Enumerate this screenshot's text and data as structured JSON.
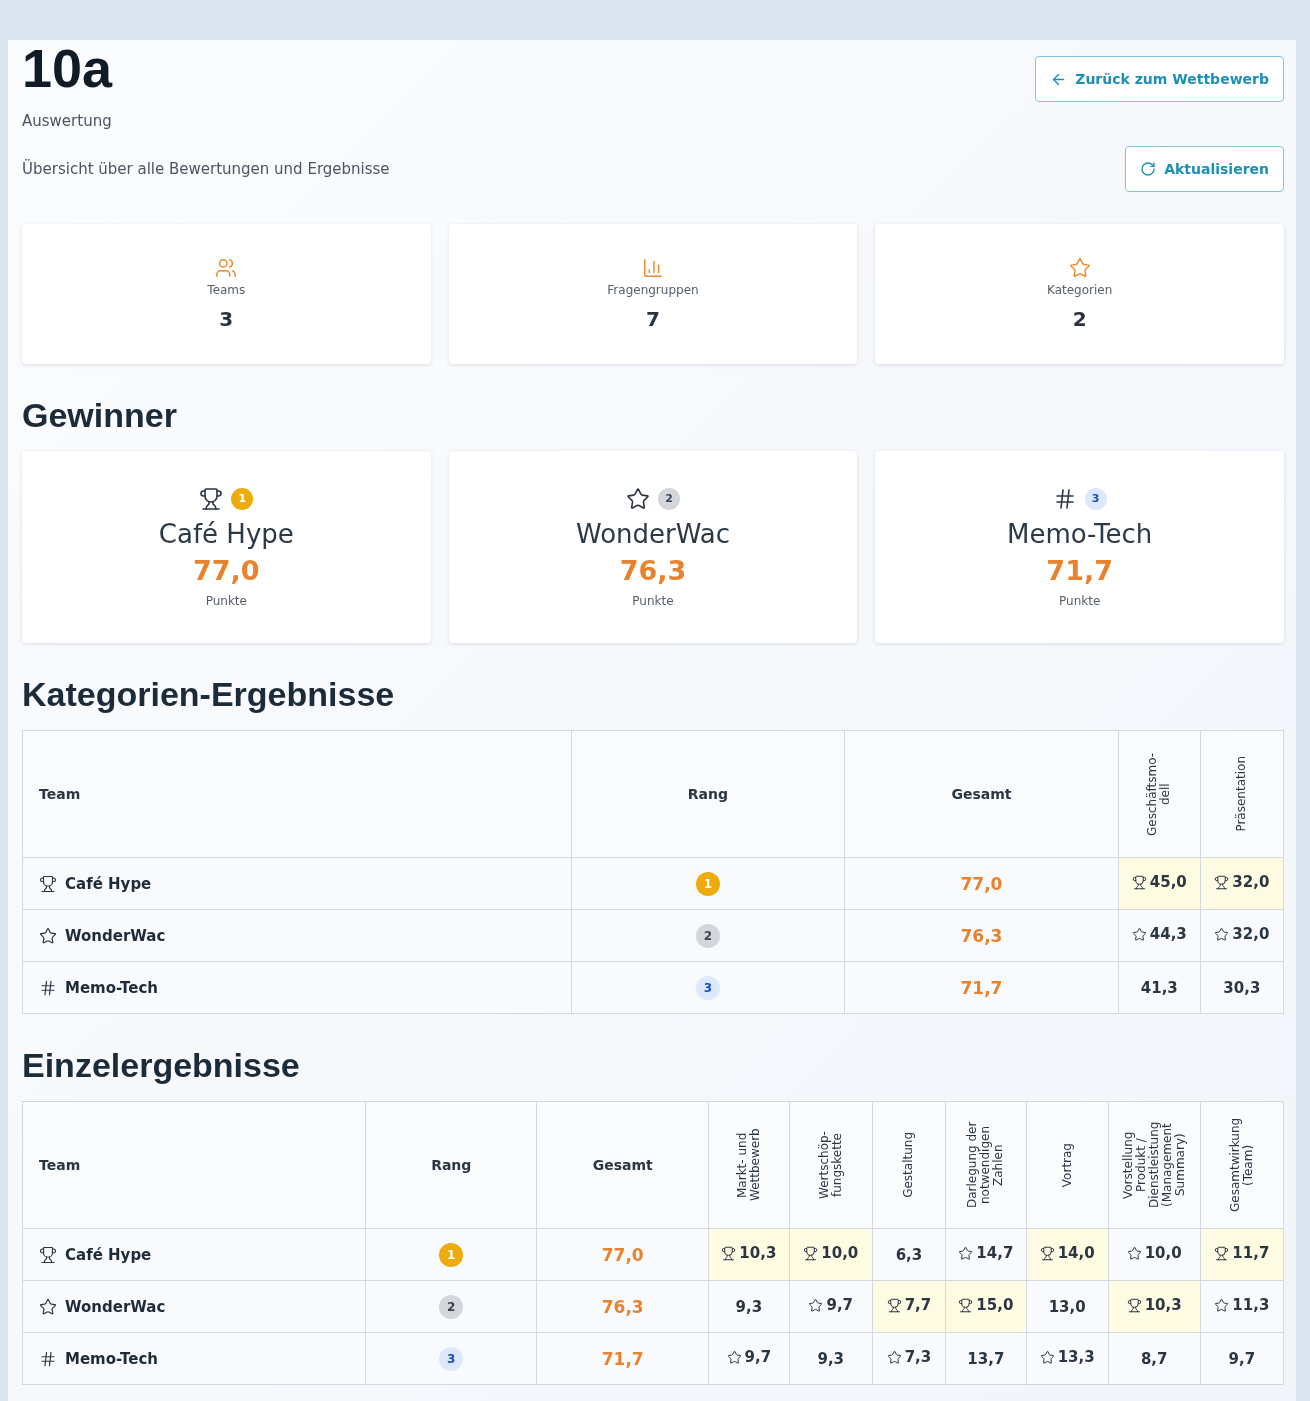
{
  "header": {
    "title": "10a",
    "subtitle": "Auswertung",
    "description": "Übersicht über alle Bewertungen und Ergebnisse",
    "back_button": "Zurück zum Wettbewerb",
    "refresh_button": "Aktualisieren"
  },
  "stats": [
    {
      "kind": "teams",
      "label": "Teams",
      "value": "3"
    },
    {
      "kind": "groups",
      "label": "Fragengruppen",
      "value": "7"
    },
    {
      "kind": "categories",
      "label": "Kategorien",
      "value": "2"
    }
  ],
  "winners_heading": "Gewinner",
  "winners": [
    {
      "kind": "first",
      "badge": "1",
      "name": "Café Hype",
      "score": "77,0",
      "unit": "Punkte"
    },
    {
      "kind": "second",
      "badge": "2",
      "name": "WonderWac",
      "score": "76,3",
      "unit": "Punkte"
    },
    {
      "kind": "third",
      "badge": "3",
      "name": "Memo-Tech",
      "score": "71,7",
      "unit": "Punkte"
    }
  ],
  "category_results": {
    "heading": "Kategorien-Ergebnisse",
    "columns": [
      "Team",
      "Rang",
      "Gesamt",
      "Geschäftsmo-dell",
      "Präsentation"
    ],
    "rows": [
      {
        "kind": "first",
        "cells": [
          {
            "kind": "team",
            "text": "Café Hype"
          },
          {
            "kind": "rank",
            "text": "1"
          },
          {
            "kind": "total",
            "text": "77,0"
          },
          {
            "kind": "top",
            "text": "45,0"
          },
          {
            "kind": "top",
            "text": "32,0"
          }
        ]
      },
      {
        "kind": "second",
        "cells": [
          {
            "kind": "team",
            "text": "WonderWac"
          },
          {
            "kind": "rank",
            "text": "2"
          },
          {
            "kind": "total",
            "text": "76,3"
          },
          {
            "kind": "runner_up",
            "text": "44,3"
          },
          {
            "kind": "runner_up",
            "text": "32,0"
          }
        ]
      },
      {
        "kind": "third",
        "cells": [
          {
            "kind": "team",
            "text": "Memo-Tech"
          },
          {
            "kind": "rank",
            "text": "3"
          },
          {
            "kind": "total",
            "text": "71,7"
          },
          {
            "kind": "plain",
            "text": "41,3"
          },
          {
            "kind": "plain",
            "text": "30,3"
          }
        ]
      }
    ]
  },
  "single_results": {
    "heading": "Einzelergebnisse",
    "columns": [
      "Team",
      "Rang",
      "Gesamt",
      "Markt- und Wettbewerb",
      "Wertschöp-fungskette",
      "Gestaltung",
      "Darlegung der notwendigen Zahlen",
      "Vortrag",
      "Vorstellung Produkt / Dienstleistung (Management Summary)",
      "Gesamtwirkung (Team)"
    ],
    "rows": [
      {
        "kind": "first",
        "cells": [
          {
            "kind": "team",
            "text": "Café Hype"
          },
          {
            "kind": "rank",
            "text": "1"
          },
          {
            "kind": "total",
            "text": "77,0"
          },
          {
            "kind": "top",
            "text": "10,3"
          },
          {
            "kind": "top",
            "text": "10,0"
          },
          {
            "kind": "plain",
            "text": "6,3"
          },
          {
            "kind": "runner_up",
            "text": "14,7"
          },
          {
            "kind": "top",
            "text": "14,0"
          },
          {
            "kind": "runner_up",
            "text": "10,0"
          },
          {
            "kind": "top",
            "text": "11,7"
          }
        ]
      },
      {
        "kind": "second",
        "cells": [
          {
            "kind": "team",
            "text": "WonderWac"
          },
          {
            "kind": "rank",
            "text": "2"
          },
          {
            "kind": "total",
            "text": "76,3"
          },
          {
            "kind": "plain",
            "text": "9,3"
          },
          {
            "kind": "runner_up",
            "text": "9,7"
          },
          {
            "kind": "top",
            "text": "7,7"
          },
          {
            "kind": "top",
            "text": "15,0"
          },
          {
            "kind": "plain",
            "text": "13,0"
          },
          {
            "kind": "top",
            "text": "10,3"
          },
          {
            "kind": "runner_up",
            "text": "11,3"
          }
        ]
      },
      {
        "kind": "third",
        "cells": [
          {
            "kind": "team",
            "text": "Memo-Tech"
          },
          {
            "kind": "rank",
            "text": "3"
          },
          {
            "kind": "total",
            "text": "71,7"
          },
          {
            "kind": "runner_up",
            "text": "9,7"
          },
          {
            "kind": "plain",
            "text": "9,3"
          },
          {
            "kind": "runner_up",
            "text": "7,3"
          },
          {
            "kind": "plain",
            "text": "13,7"
          },
          {
            "kind": "runner_up",
            "text": "13,3"
          },
          {
            "kind": "plain",
            "text": "8,7"
          },
          {
            "kind": "plain",
            "text": "9,7"
          }
        ]
      }
    ]
  }
}
